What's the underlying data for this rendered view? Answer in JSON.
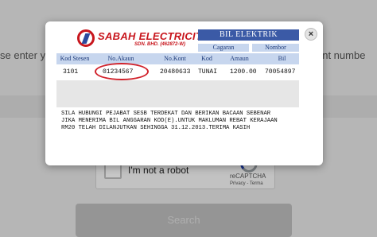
{
  "background": {
    "left_text": "se enter y",
    "right_text": "unt numbe",
    "captcha": {
      "label": "I'm not a robot",
      "brand": "reCAPTCHA",
      "links": "Privacy - Terma"
    },
    "search_label": "Search"
  },
  "modal": {
    "close_icon": "×",
    "bill": {
      "company": "SABAH ELECTRICITY",
      "company_sub": "SDN. BHD. (462872-W)",
      "title": "BIL ELEKTRIK",
      "headers": {
        "kod_stesen": "Kod Stesen",
        "no_akaun": "No.Akaun",
        "no_kont": "No.Kont",
        "kod": "Kod",
        "cagaran": "Cagaran",
        "amaun": "Amaun",
        "nombor": "Nombor",
        "bil": "Bil"
      },
      "row": {
        "kod_stesen": "3101",
        "no_akaun": "01234567",
        "no_kont": "20480633",
        "kod": "TUNAI",
        "amaun": "1200.00",
        "bil": "70054897"
      },
      "notice": [
        "SILA HUBUNGI PEJABAT SESB TERDEKAT DAN BERIKAN BACAAN SEBENAR",
        "JIKA MENERIMA BIL ANGGARAN KOD(E).UNTUK MAKLUMAN REBAT KERAJAAN",
        "RM20 TELAH DILANJUTKAN SEHINGGA 31.12.2013.TERIMA KASIH"
      ]
    }
  },
  "colors": {
    "brand_red": "#c8161d",
    "brand_blue": "#3b5aa6",
    "header_fill": "#c7d6ee"
  }
}
